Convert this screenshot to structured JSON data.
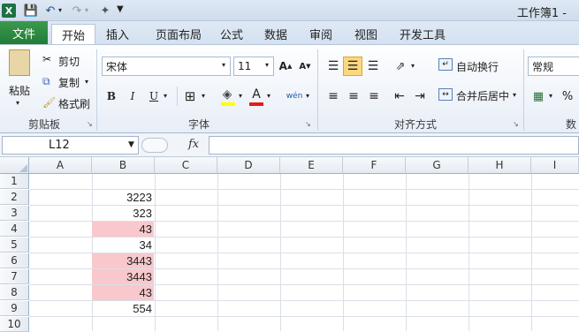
{
  "window": {
    "title": "工作簿1 -"
  },
  "quick_access": {
    "save": "save-icon",
    "undo": "undo-icon",
    "redo": "redo-icon",
    "custom": "customize-icon"
  },
  "ribbon": {
    "file_tab": "文件",
    "tabs": [
      "开始",
      "插入",
      "页面布局",
      "公式",
      "数据",
      "审阅",
      "视图",
      "开发工具"
    ],
    "clipboard": {
      "paste": "粘贴",
      "cut": "剪切",
      "copy": "复制",
      "format_painter": "格式刷",
      "label": "剪贴板"
    },
    "font": {
      "name": "宋体",
      "size": "11",
      "grow": "A",
      "shrink": "A",
      "bold": "B",
      "italic": "I",
      "underline": "U",
      "label": "字体",
      "phonetic": "wén"
    },
    "alignment": {
      "wrap": "自动换行",
      "merge": "合并后居中",
      "label": "对齐方式"
    },
    "number": {
      "format": "常规",
      "percent": "%",
      "label": "数"
    }
  },
  "formula_bar": {
    "name_box": "L12",
    "fx": "fx",
    "value": ""
  },
  "sheet": {
    "columns": [
      "A",
      "B",
      "C",
      "D",
      "E",
      "F",
      "G",
      "H",
      "I"
    ],
    "rows": [
      "1",
      "2",
      "3",
      "4",
      "5",
      "6",
      "7",
      "8",
      "9",
      "10"
    ],
    "b_values": [
      "",
      "3223",
      "323",
      "43",
      "34",
      "3443",
      "3443",
      "43",
      "554",
      ""
    ],
    "highlight_color": "#f8c8cc"
  }
}
